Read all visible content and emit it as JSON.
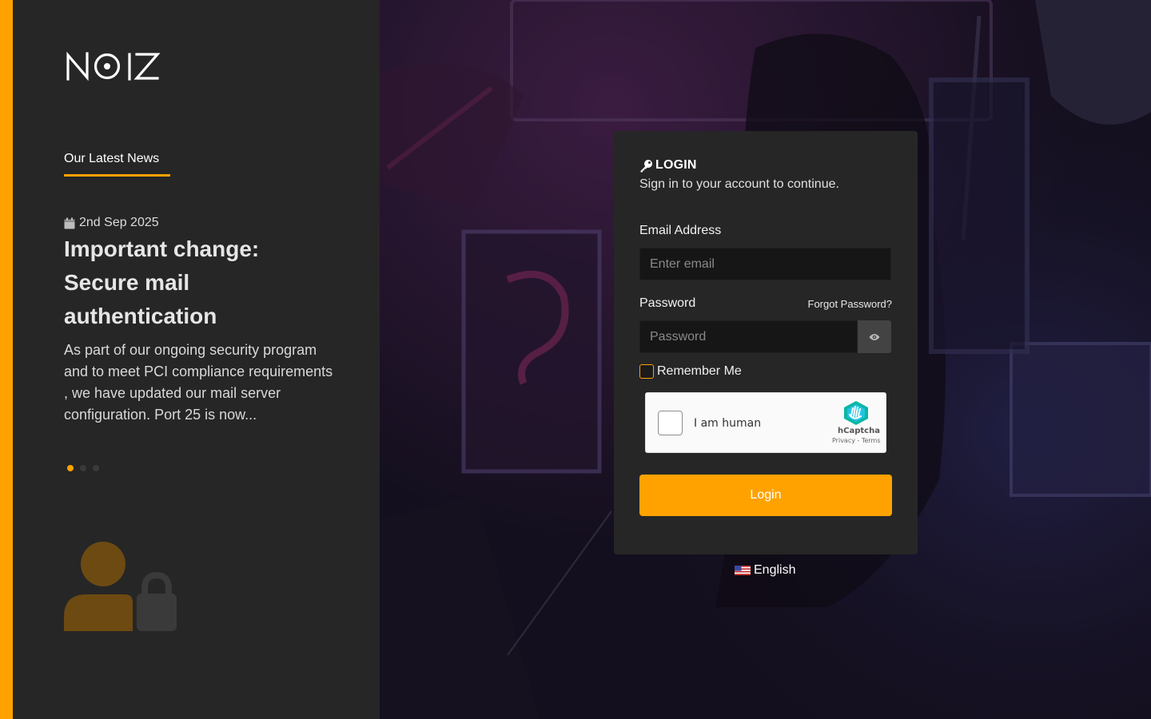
{
  "brand": {
    "logo_text": "NOIZ"
  },
  "colors": {
    "accent": "#ffa200",
    "panel": "#262626",
    "input_bg": "#161616"
  },
  "news": {
    "section_title": "Our Latest News",
    "date_icon": "calendar-icon",
    "date": "2nd Sep 2025",
    "title": "Important change: Secure mail authentication",
    "body": "As part of our ongoing security program and to meet PCI compliance requirements , we have updated our mail server configuration. Port 25 is now...",
    "slides": 3,
    "active_slide": 1
  },
  "login": {
    "icon": "key-icon",
    "heading": "LOGIN",
    "subtitle": "Sign in to your account to continue.",
    "email_label": "Email Address",
    "email_placeholder": "Enter email",
    "password_label": "Password",
    "password_placeholder": "Password",
    "forgot_link": "Forgot Password?",
    "remember_label": "Remember Me",
    "submit_label": "Login"
  },
  "captcha": {
    "text": "I am human",
    "brand": "hCaptcha",
    "links": "Privacy - Terms"
  },
  "language": {
    "flag_icon": "us-flag-icon",
    "label": "English"
  }
}
